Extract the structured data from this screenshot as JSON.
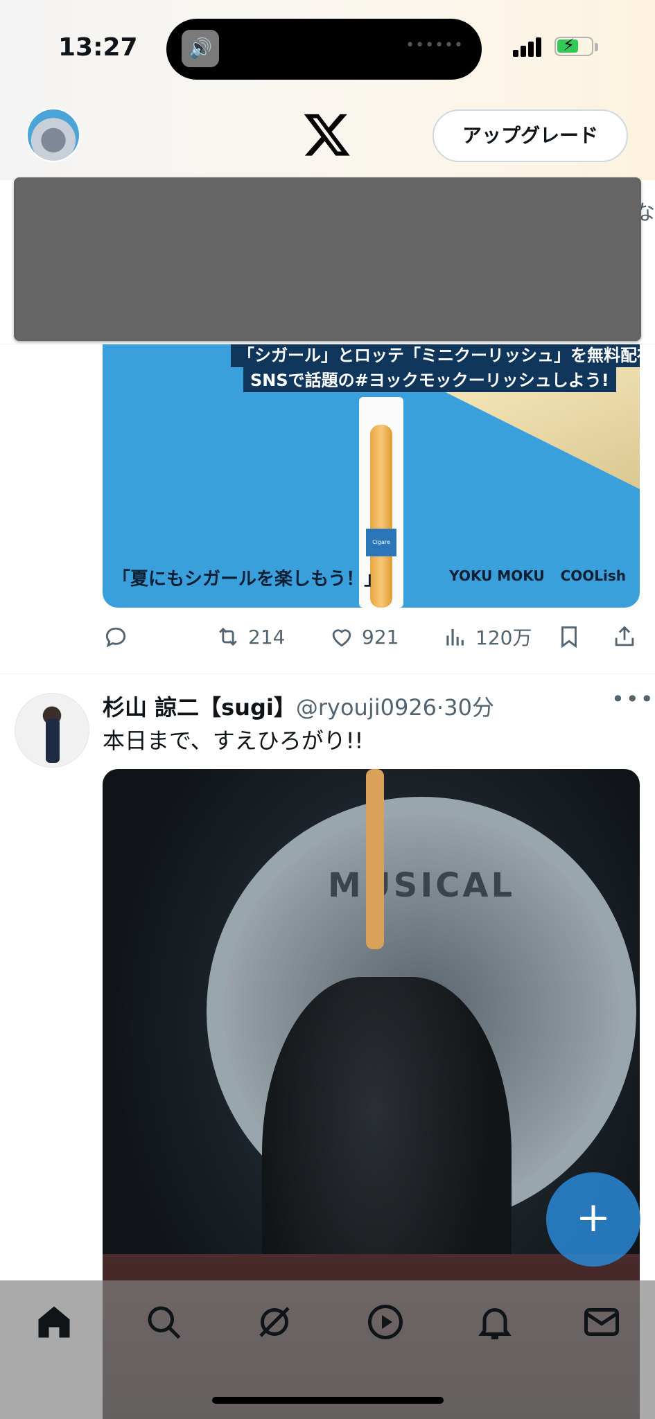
{
  "status_bar": {
    "time": "13:27",
    "battery_charging": true,
    "signal_bars": 4
  },
  "header": {
    "upgrade_label": "アップグレード",
    "logo": "x-logo-icon",
    "peek_text": "な"
  },
  "promo_tweet": {
    "image": {
      "line1": "「シガール」とロッテ「ミニクーリッシュ」を無料配布！",
      "line2": "SNSで話題の#ヨックモックーリッシュしよう!",
      "slogan": "「夏にもシガールを楽しもう！」",
      "brand1": "YOKU MOKU",
      "brand2": "COOLish",
      "package_label": "Cigare"
    },
    "actions": {
      "reply_icon": "comment-icon",
      "retweets": "214",
      "likes": "921",
      "views": "120万"
    }
  },
  "tweet2": {
    "name": "杉山 諒二【sugi】",
    "handle": "@ryouji0926",
    "sep": "·",
    "time": "30分",
    "text": "本日まで、すえひろがり!!",
    "media_text": "MUSICAL"
  },
  "fab": {
    "icon": "compose-plus-icon",
    "label": "+"
  },
  "bottom_nav": {
    "items": [
      "home-icon",
      "search-icon",
      "grok-icon",
      "video-icon",
      "notifications-icon",
      "messages-icon"
    ]
  },
  "colors": {
    "secondary_text": "#536471",
    "accent": "#1d9bf0"
  }
}
